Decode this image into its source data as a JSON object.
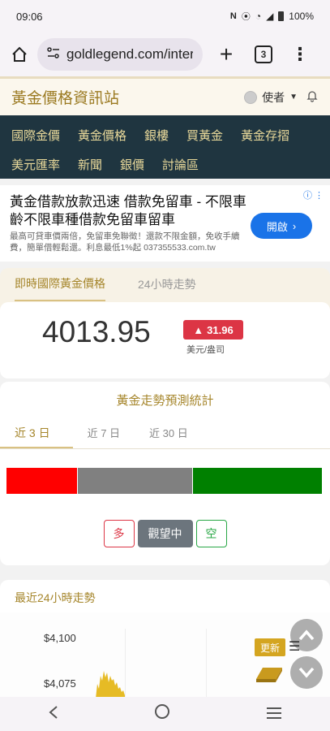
{
  "status_bar": {
    "time": "09:06",
    "battery": "100%"
  },
  "browser": {
    "url": "goldlegend.com/interi",
    "tab_count": "3"
  },
  "site": {
    "title": "黃金價格資訊站",
    "user_label": "使者"
  },
  "nav": {
    "row1": [
      "國際金價",
      "黃金價格",
      "銀樓",
      "買黃金",
      "黃金存摺"
    ],
    "row2": [
      "美元匯率",
      "新聞",
      "銀價",
      "討論區"
    ]
  },
  "ad": {
    "title": "黃金借款放款迅速 借款免留車 - 不限車齡不限車種借款免留車留車",
    "desc": "最高可貸車價兩倍，免留車免聯徵！還款不限金額，免收手續費，簡單借輕鬆還。利息最低1%起 037355533.com.tw",
    "button": "開啟"
  },
  "price": {
    "tab_live": "即時國際黃金價格",
    "tab_24h": "24小時走勢",
    "value": "4013.95",
    "change": "31.96",
    "change_arrow": "▲",
    "unit": "美元/盎司"
  },
  "forecast": {
    "title": "黃金走勢預測統計",
    "periods": [
      "近 3 日",
      "近 7 日",
      "近 30 日"
    ],
    "shares": [
      {
        "label": "long",
        "fraction": 0.225,
        "color": "#ff0000"
      },
      {
        "label": "wait",
        "fraction": 0.365,
        "color": "#808080"
      },
      {
        "label": "short",
        "fraction": 0.41,
        "color": "#008000"
      }
    ],
    "stance_long": "多",
    "stance_wait": "觀望中",
    "stance_short": "空"
  },
  "trend24": {
    "title": "最近24小時走勢",
    "yticks": [
      "$4,100",
      "$4,075"
    ]
  },
  "widgets": {
    "update": "更新"
  },
  "colors": {
    "gold": "#a5852a",
    "nav_bg": "#1f3540",
    "nav_text": "#e9d99a",
    "up_red": "#dc3545"
  }
}
